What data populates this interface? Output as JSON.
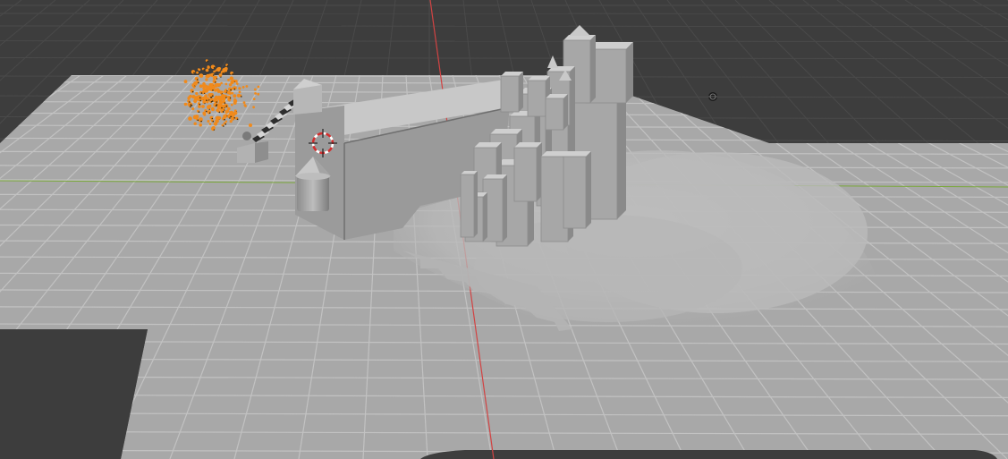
{
  "viewport": {
    "mode": "solid-shading",
    "background_color": "#3d3d3d",
    "grid_color": "#4a4a4a",
    "ground_color": "#a9a9a9",
    "ground_grid_color": "#c2c2c2",
    "x_axis_color": "#d24343",
    "y_axis_color": "#7aa83a",
    "selection_color": "#f08a1c"
  },
  "objects": [
    {
      "name": "ground-plane",
      "selected": false
    },
    {
      "name": "castle",
      "selected": false
    },
    {
      "name": "castle-wall",
      "selected": false
    },
    {
      "name": "round-tower",
      "selected": false
    },
    {
      "name": "staircase",
      "selected": false
    },
    {
      "name": "particle-system",
      "selected": true
    },
    {
      "name": "smoke-volume",
      "selected": false
    }
  ],
  "icons": {
    "cursor": "3d-cursor-icon",
    "light": "light-icon"
  }
}
